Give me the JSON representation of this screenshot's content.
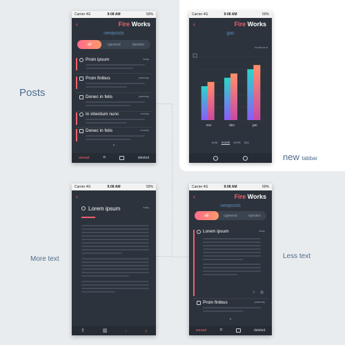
{
  "status": {
    "carrier": "Carrier",
    "network": "4G",
    "time": "9:08 AM",
    "battery": "50%"
  },
  "brand": {
    "fire": "Fire",
    "works": "Works"
  },
  "labels": {
    "posts": "Posts",
    "new_word": "new",
    "tabbar_word": "tabbar",
    "more_text": "More text",
    "less_text": "Less text"
  },
  "posts_screen": {
    "title": "newposts",
    "tabs": [
      "all",
      "cgeneral",
      "ripostes"
    ],
    "items": [
      {
        "title": "Proin ipsum",
        "date": "today"
      },
      {
        "title": "Proin finibus",
        "date": "yesterday"
      },
      {
        "title": "Donec in felis",
        "date": "yesterday"
      },
      {
        "title": "In interdum nunc",
        "date": "monday"
      },
      {
        "title": "Donec in felis",
        "date": "monday"
      }
    ],
    "tabbar": {
      "unread": "unread",
      "deleted": "deleted"
    }
  },
  "chart_screen": {
    "title": "gas",
    "filter": "locations",
    "period_tabs": [
      "year",
      "month",
      "week",
      "day"
    ]
  },
  "chart_data": {
    "type": "bar",
    "categories": [
      "nov",
      "dec",
      "jan"
    ],
    "series": [
      {
        "values": [
          8,
          10,
          12
        ]
      },
      {
        "values": [
          9,
          11,
          13
        ]
      }
    ],
    "ylim": [
      0,
      15
    ],
    "colors": [
      "#2ad6c9",
      "#ff8f6b"
    ]
  },
  "detail_screen": {
    "title": "Lorem ipsum",
    "date": "today"
  },
  "less_screen": {
    "title": "newposts",
    "tabs": [
      "all",
      "cgeneral",
      "ripostes"
    ],
    "items": [
      {
        "title": "Lorem ipsum",
        "date": "today"
      },
      {
        "title": "Proin finibus",
        "date": "yesterday"
      }
    ],
    "tabbar": {
      "unread": "unread",
      "deleted": "deleted"
    }
  }
}
